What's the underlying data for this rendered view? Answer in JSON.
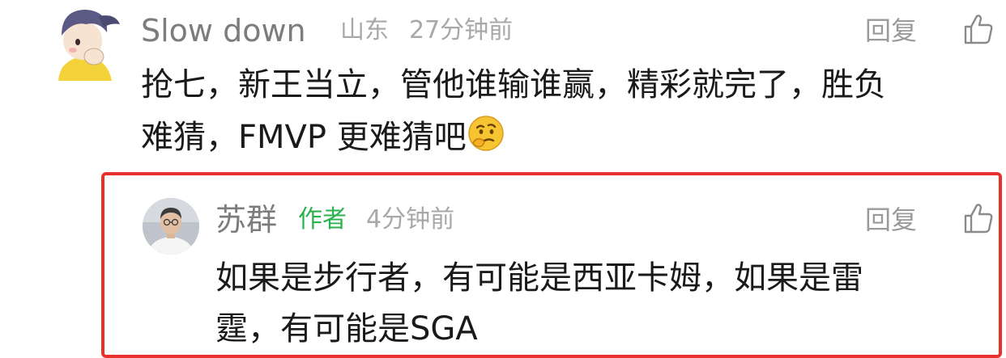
{
  "comment": {
    "username": "Slow down",
    "location": "山东",
    "time": "27分钟前",
    "reply_label": "回复",
    "text_line1": "抢七，新王当立，管他谁输谁赢，精彩就完了，胜负",
    "text_line2": "难猜，FMVP 更难猜吧",
    "emoji": "thinking-face-emoji",
    "avatar_icon": "cartoon-avatar"
  },
  "reply": {
    "username": "苏群",
    "badge": "作者",
    "time": "4分钟前",
    "reply_label": "回复",
    "text_line1": "如果是步行者，有可能是西亚卡姆，如果是雷",
    "text_line2": "霆，有可能是SGA",
    "avatar_icon": "photo-avatar",
    "highlight_color": "#e8312a"
  },
  "colors": {
    "author_badge": "#2bb24c",
    "username": "#7c7c7c",
    "meta": "#a8a8a8"
  }
}
